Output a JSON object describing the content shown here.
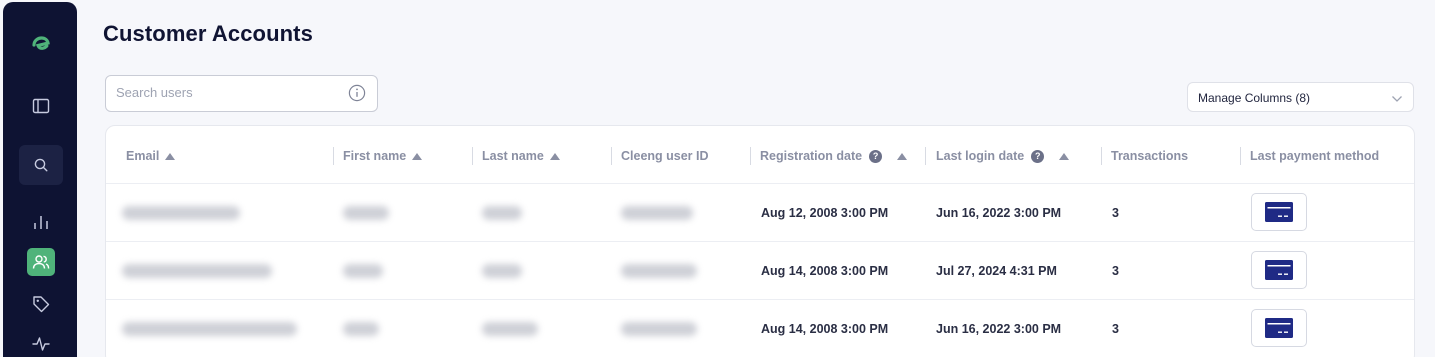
{
  "page": {
    "title": "Customer Accounts"
  },
  "search": {
    "placeholder": "Search users"
  },
  "manage_columns": {
    "label": "Manage Columns (8)"
  },
  "table": {
    "columns": [
      {
        "label": "Email",
        "sortable": true,
        "help": false
      },
      {
        "label": "First name",
        "sortable": true,
        "help": false
      },
      {
        "label": "Last name",
        "sortable": true,
        "help": false
      },
      {
        "label": "Cleeng user ID",
        "sortable": false,
        "help": false
      },
      {
        "label": "Registration date",
        "sortable": true,
        "help": true
      },
      {
        "label": "Last login date",
        "sortable": true,
        "help": true
      },
      {
        "label": "Transactions",
        "sortable": false,
        "help": false
      },
      {
        "label": "Last payment method",
        "sortable": false,
        "help": false
      }
    ],
    "rows": [
      {
        "registration_date": "Aug 12, 2008 3:00 PM",
        "last_login_date": "Jun 16, 2022 3:00 PM",
        "transactions": "3",
        "payment_icon": "credit-card-icon"
      },
      {
        "registration_date": "Aug 14, 2008 3:00 PM",
        "last_login_date": "Jul 27, 2024 4:31 PM",
        "transactions": "3",
        "payment_icon": "credit-card-icon"
      },
      {
        "registration_date": "Aug 14, 2008 3:00 PM",
        "last_login_date": "Jun 16, 2022 3:00 PM",
        "transactions": "3",
        "payment_icon": "credit-card-icon"
      }
    ]
  },
  "sidebar": {
    "icons": [
      "logo-icon",
      "panel-icon",
      "search-icon",
      "bar-chart-icon",
      "users-icon",
      "tag-icon",
      "activity-icon"
    ],
    "active": "users-icon"
  },
  "colors": {
    "sidebar_bg": "#0e1333",
    "accent": "#4fb37a",
    "card_icon": "#1f2a85"
  }
}
